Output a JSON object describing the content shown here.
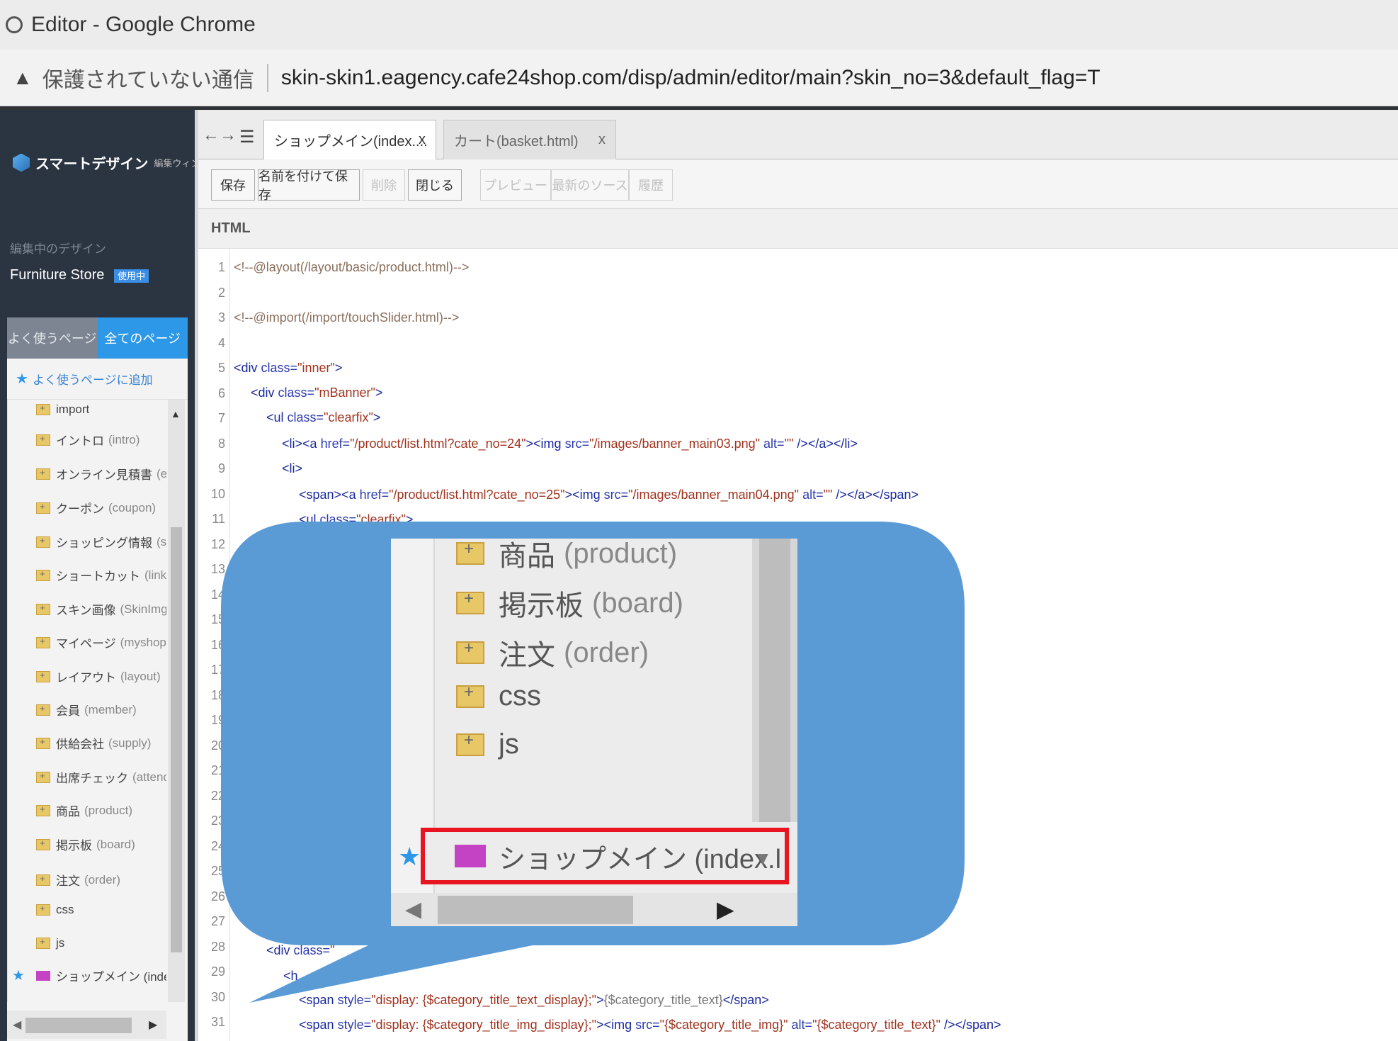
{
  "browser": {
    "window_title": "Editor - Google Chrome",
    "security_label": "保護されていない通信",
    "url": "skin-skin1.eagency.cafe24shop.com/disp/admin/editor/main?skin_no=3&default_flag=T"
  },
  "sidebar": {
    "brand": "スマートデザイン",
    "brand_sub": "編集ウィンドウ",
    "editing_label": "編集中のデザイン",
    "design_name": "Furniture Store",
    "in_use_badge": "使用中",
    "tabs": [
      "よく使うページ",
      "全てのページ"
    ],
    "add_favorite": "よく使うページに追加",
    "tree_items": [
      {
        "label": "import",
        "en": ""
      },
      {
        "label": "イントロ",
        "en": "(intro)"
      },
      {
        "label": "オンライン見積書",
        "en": "(estim"
      },
      {
        "label": "クーポン",
        "en": "(coupon)"
      },
      {
        "label": "ショッピング情報",
        "en": "(shop"
      },
      {
        "label": "ショートカット",
        "en": "(link)"
      },
      {
        "label": "スキン画像",
        "en": "(SkinImg)"
      },
      {
        "label": "マイページ",
        "en": "(myshop)"
      },
      {
        "label": "レイアウト",
        "en": "(layout)"
      },
      {
        "label": "会員",
        "en": "(member)"
      },
      {
        "label": "供給会社",
        "en": "(supply)"
      },
      {
        "label": "出席チェック",
        "en": "(attend)"
      },
      {
        "label": "商品",
        "en": "(product)"
      },
      {
        "label": "掲示板",
        "en": "(board)"
      },
      {
        "label": "注文",
        "en": "(order)"
      },
      {
        "label": "css",
        "en": ""
      },
      {
        "label": "js",
        "en": ""
      }
    ],
    "selected_page": "ショップメイン (index.l"
  },
  "editor": {
    "tabs": [
      {
        "label": "ショップメイン(index....",
        "close": "x"
      },
      {
        "label": "カート(basket.html)",
        "close": "x"
      }
    ],
    "toolbar": [
      "保存",
      "名前を付けて保存",
      "削除",
      "閉じる",
      "プレビュー",
      "最新のソース",
      "履歴"
    ],
    "section": "HTML",
    "line_numbers": [
      "1",
      "2",
      "3",
      "4",
      "5",
      "6",
      "7",
      "8",
      "9",
      "10",
      "11",
      "12",
      "13",
      "14",
      "15",
      "16",
      "17",
      "18",
      "19",
      "20",
      "21",
      "22",
      "23",
      "24",
      "25",
      "26",
      "27",
      "28",
      "29",
      "30",
      "31"
    ]
  },
  "zoom": {
    "items": [
      {
        "label": "商品",
        "en": "(product)"
      },
      {
        "label": "掲示板",
        "en": "(board)"
      },
      {
        "label": "注文",
        "en": "(order)"
      },
      {
        "label": "css",
        "en": ""
      },
      {
        "label": "js",
        "en": ""
      }
    ],
    "highlight_label": "ショップメイン (index.l"
  },
  "colors": {
    "sidebar_bg": "#2b3441",
    "accent_blue": "#2e98e8",
    "callout_blue": "#5b9bd5",
    "highlight_red": "#e8141f"
  }
}
